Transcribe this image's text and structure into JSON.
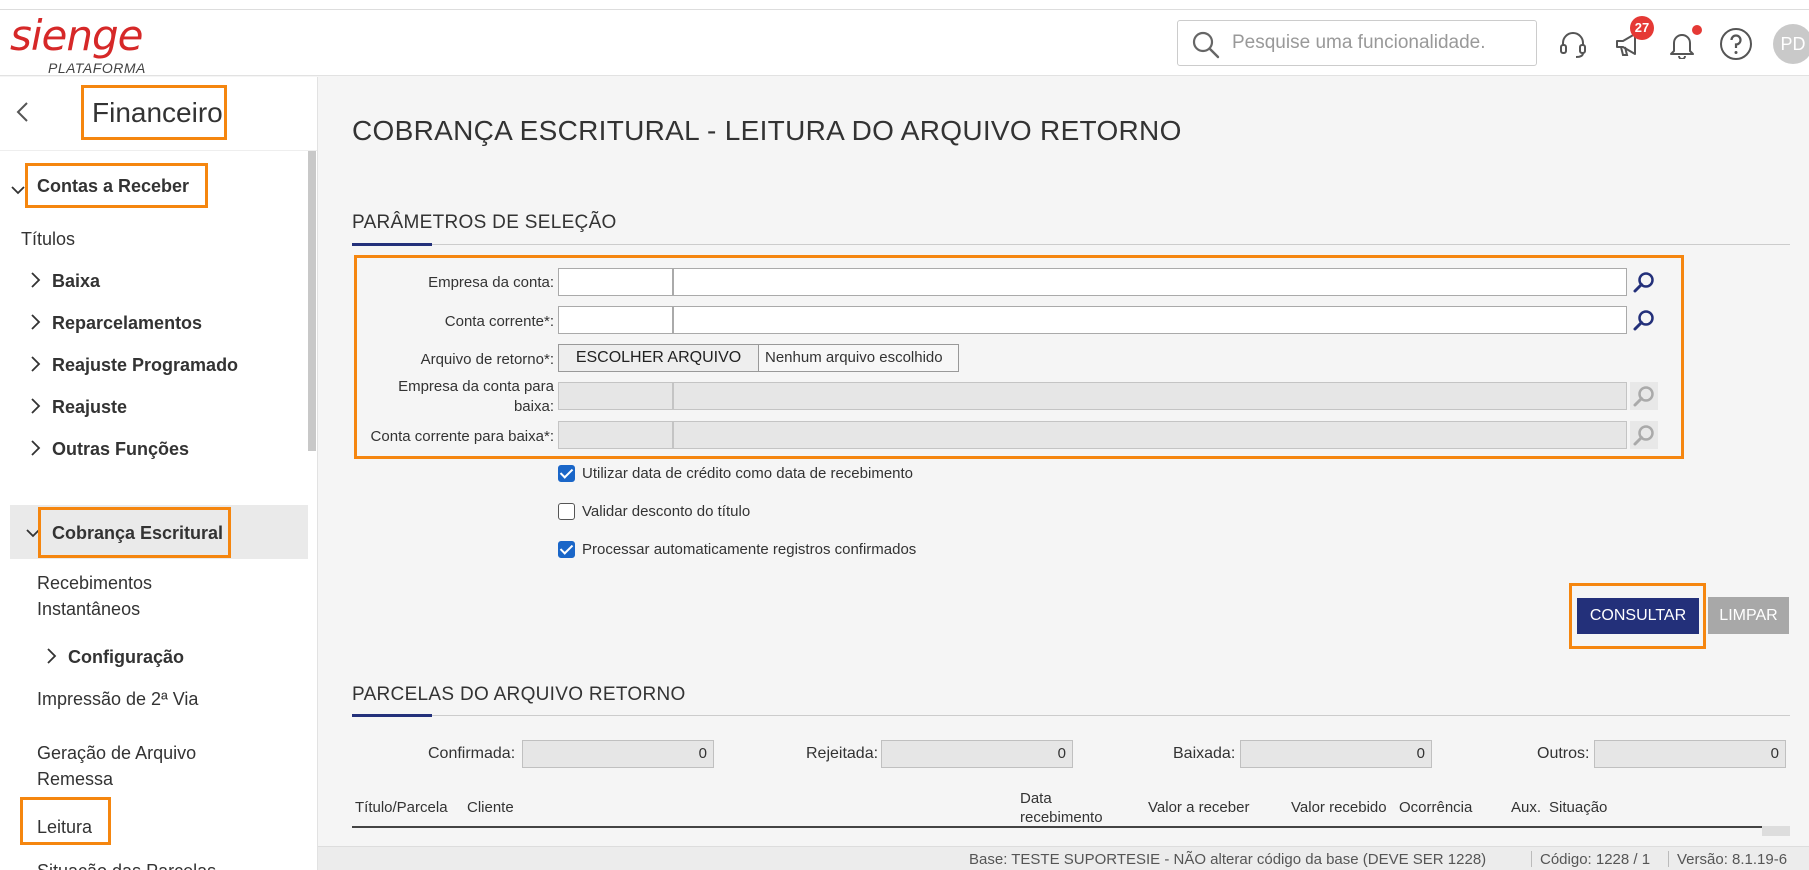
{
  "header": {
    "logo_text": "sienge",
    "logo_sub": "PLATAFORMA",
    "search_placeholder": "Pesquise uma funcionalidade.",
    "notifications_count": "27",
    "avatar_initials": "PD",
    "icons": [
      "search-icon",
      "headset-icon",
      "megaphone-icon",
      "bell-icon",
      "help-icon"
    ]
  },
  "sidebar": {
    "module_title": "Financeiro",
    "section": "Contas a Receber",
    "items": [
      {
        "label": "Títulos"
      },
      {
        "label": "Baixa"
      },
      {
        "label": "Reparcelamentos"
      },
      {
        "label": "Reajuste Programado"
      },
      {
        "label": "Reajuste"
      },
      {
        "label": "Outras Funções"
      },
      {
        "label": "Cobrança Escritural"
      },
      {
        "label": "Recebimentos"
      },
      {
        "label": "Instantâneos"
      },
      {
        "label": "Configuração"
      },
      {
        "label": "Impressão de 2ª Via"
      },
      {
        "label": "Geração de Arquivo"
      },
      {
        "label": "Remessa"
      },
      {
        "label": "Leitura"
      },
      {
        "label": "Situação das Parcelas"
      }
    ]
  },
  "main": {
    "page_title": "COBRANÇA ESCRITURAL - LEITURA DO ARQUIVO RETORNO",
    "params_title": "PARÂMETROS DE SELEÇÃO",
    "fields": {
      "empresa_conta": "Empresa da conta:",
      "conta_corrente": "Conta corrente*:",
      "arquivo_retorno": "Arquivo de retorno*:",
      "empresa_baixa_1": "Empresa da conta para",
      "empresa_baixa_2": "baixa:",
      "conta_baixa": "Conta corrente para baixa*:"
    },
    "file_button": "ESCOLHER ARQUIVO",
    "file_status": "Nenhum arquivo escolhido",
    "checkboxes": [
      {
        "label": "Utilizar data de crédito como data de recebimento",
        "checked": true
      },
      {
        "label": "Validar desconto do título",
        "checked": false
      },
      {
        "label": "Processar automaticamente registros confirmados",
        "checked": true
      }
    ],
    "buttons": {
      "consultar": "CONSULTAR",
      "limpar": "LIMPAR"
    },
    "parcelas_title": "PARCELAS DO ARQUIVO RETORNO",
    "counters": [
      {
        "label": "Confirmada:",
        "value": "0"
      },
      {
        "label": "Rejeitada:",
        "value": "0"
      },
      {
        "label": "Baixada:",
        "value": "0"
      },
      {
        "label": "Outros:",
        "value": "0"
      }
    ],
    "table_headers": {
      "titulo": "Título/Parcela",
      "cliente": "Cliente",
      "data_1": "Data",
      "data_2": "recebimento",
      "valor_receber": "Valor a receber",
      "valor_recebido": "Valor recebido",
      "ocorrencia": "Ocorrência",
      "aux": "Aux.",
      "situacao": "Situação"
    }
  },
  "footer": {
    "base": "Base: TESTE SUPORTESIE - NÃO alterar código da base (DEVE SER 1228)",
    "codigo": "Código: 1228 / 1",
    "versao": "Versão: 8.1.19-6"
  },
  "colors": {
    "accent": "#23307a",
    "highlight": "#f5860f",
    "brand": "#d62828"
  }
}
